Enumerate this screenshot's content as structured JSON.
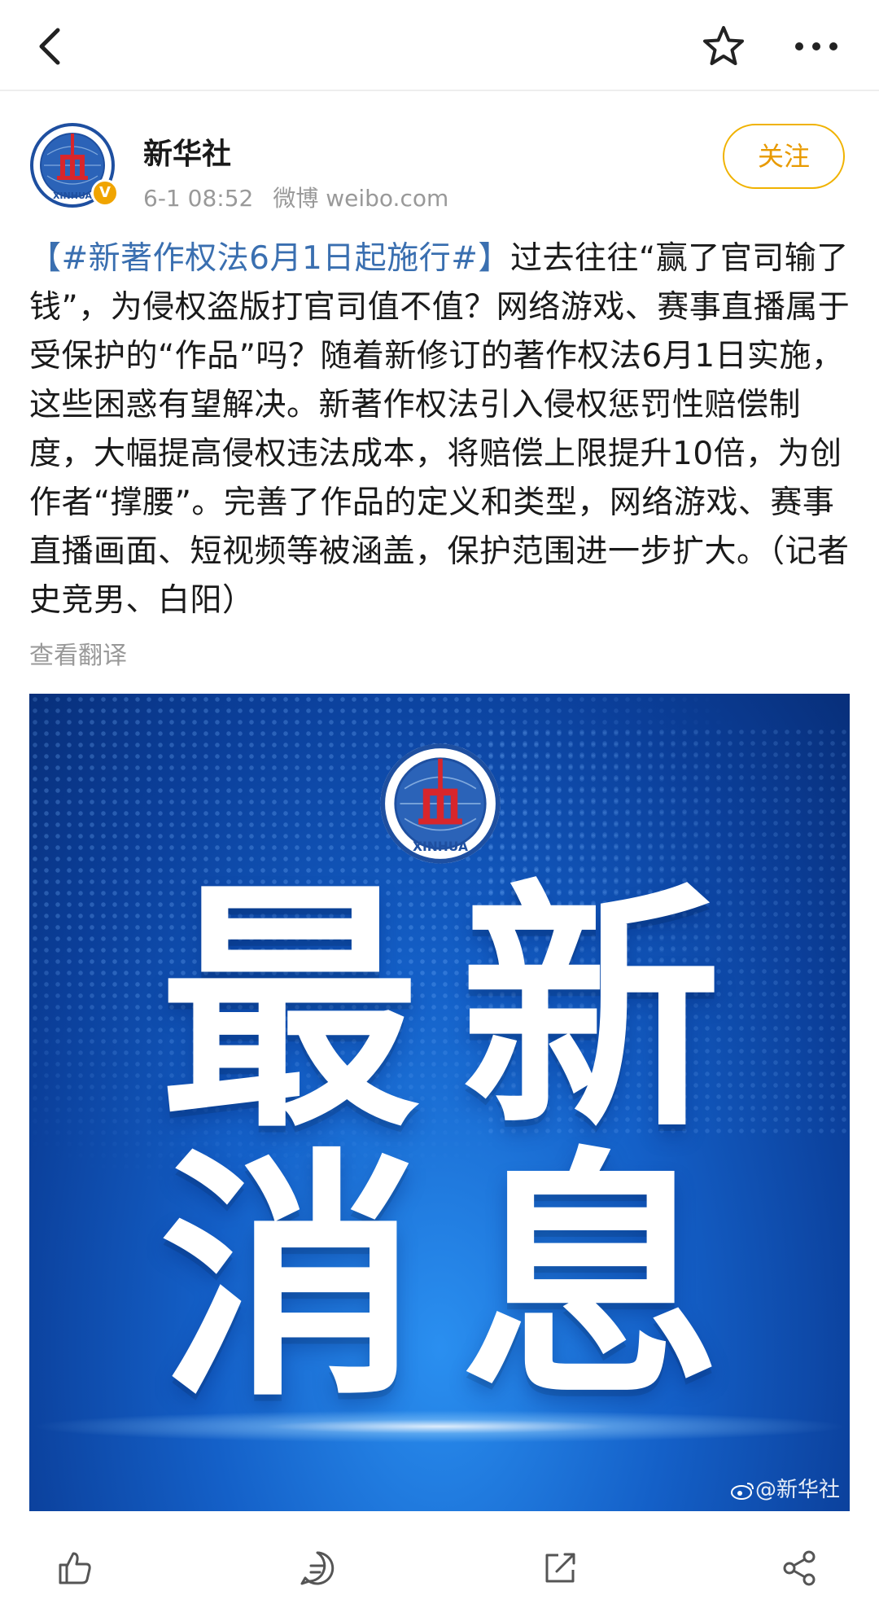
{
  "topbar": {
    "back_icon": "chevron-left-icon",
    "favorite_icon": "star-outline-icon",
    "more_icon": "more-horizontal-icon"
  },
  "author": {
    "name": "新华社",
    "time": "6-1 08:52",
    "source": "微博 weibo.com",
    "follow_label": "关注",
    "verified_mark": "V",
    "avatar_logo_text": "XINHUA"
  },
  "post": {
    "topic": "【#新著作权法6月1日起施行#】",
    "body": "过去往往“赢了官司输了钱”，为侵权盗版打官司值不值？网络游戏、赛事直播属于受保护的“作品”吗？随着新修订的著作权法6月1日实施，这些困惑有望解决。新著作权法引入侵权惩罚性赔偿制度，大幅提高侵权违法成本，将赔偿上限提升10倍，为创作者“撑腰”。完善了作品的定义和类型，网络游戏、赛事直播画面、短视频等被涵盖，保护范围进一步扩大。（记者史竞男、白阳）",
    "translate_label": "查看翻译"
  },
  "image": {
    "char1": "最",
    "char2": "新",
    "char3": "消",
    "char4": "息",
    "watermark": "@新华社",
    "logo_text": "XINHUA"
  },
  "actions": {
    "like_icon": "thumbs-up-icon",
    "comment_icon": "comment-icon",
    "repost_icon": "repost-icon",
    "share_icon": "share-icon"
  },
  "colors": {
    "topic_link": "#3a6fb0",
    "follow_accent": "#f0b200",
    "verified_badge": "#f0a400",
    "image_blue": "#1460c8"
  }
}
